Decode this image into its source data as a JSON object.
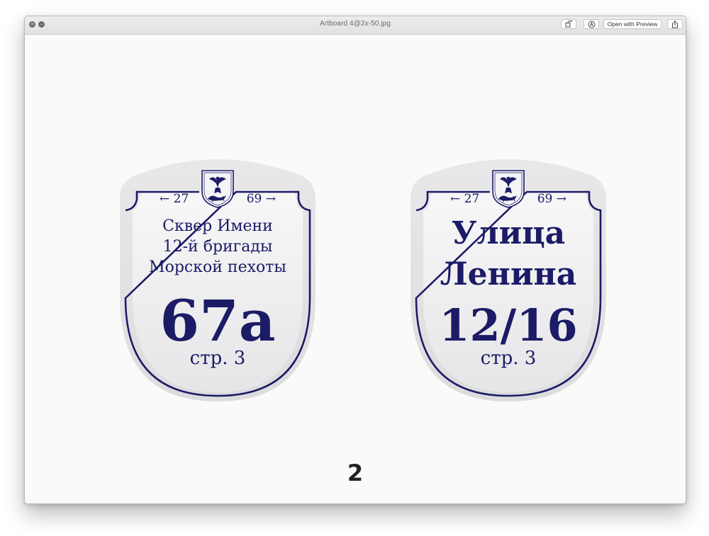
{
  "window": {
    "title": "Artboard 4@2x-50.jpg",
    "open_with_preview": "Open with Preview",
    "close_glyph": "×",
    "minimize_glyph": "–"
  },
  "icons": {
    "close": "close-icon",
    "minimize": "minimize-icon",
    "rotate": "rotate-icon",
    "markup": "markup-icon",
    "share": "share-icon",
    "coat_of_arms": "coat-of-arms-icon"
  },
  "colors": {
    "sign_ink": "#1b1b66",
    "sign_plate": "#e3e3e5",
    "sign_face": "#f4f4f6"
  },
  "signs": [
    {
      "left_number": "← 27",
      "right_number": "69 →",
      "street_lines": [
        "Сквер Имени",
        "12-й бригады",
        "Морской пехоты"
      ],
      "house_number": "67а",
      "building": "стр. 3"
    },
    {
      "left_number": "← 27",
      "right_number": "69 →",
      "street_lines": [
        "Улица",
        "Ленина"
      ],
      "house_number": "12/16",
      "building": "стр. 3"
    }
  ],
  "page_number": "2"
}
